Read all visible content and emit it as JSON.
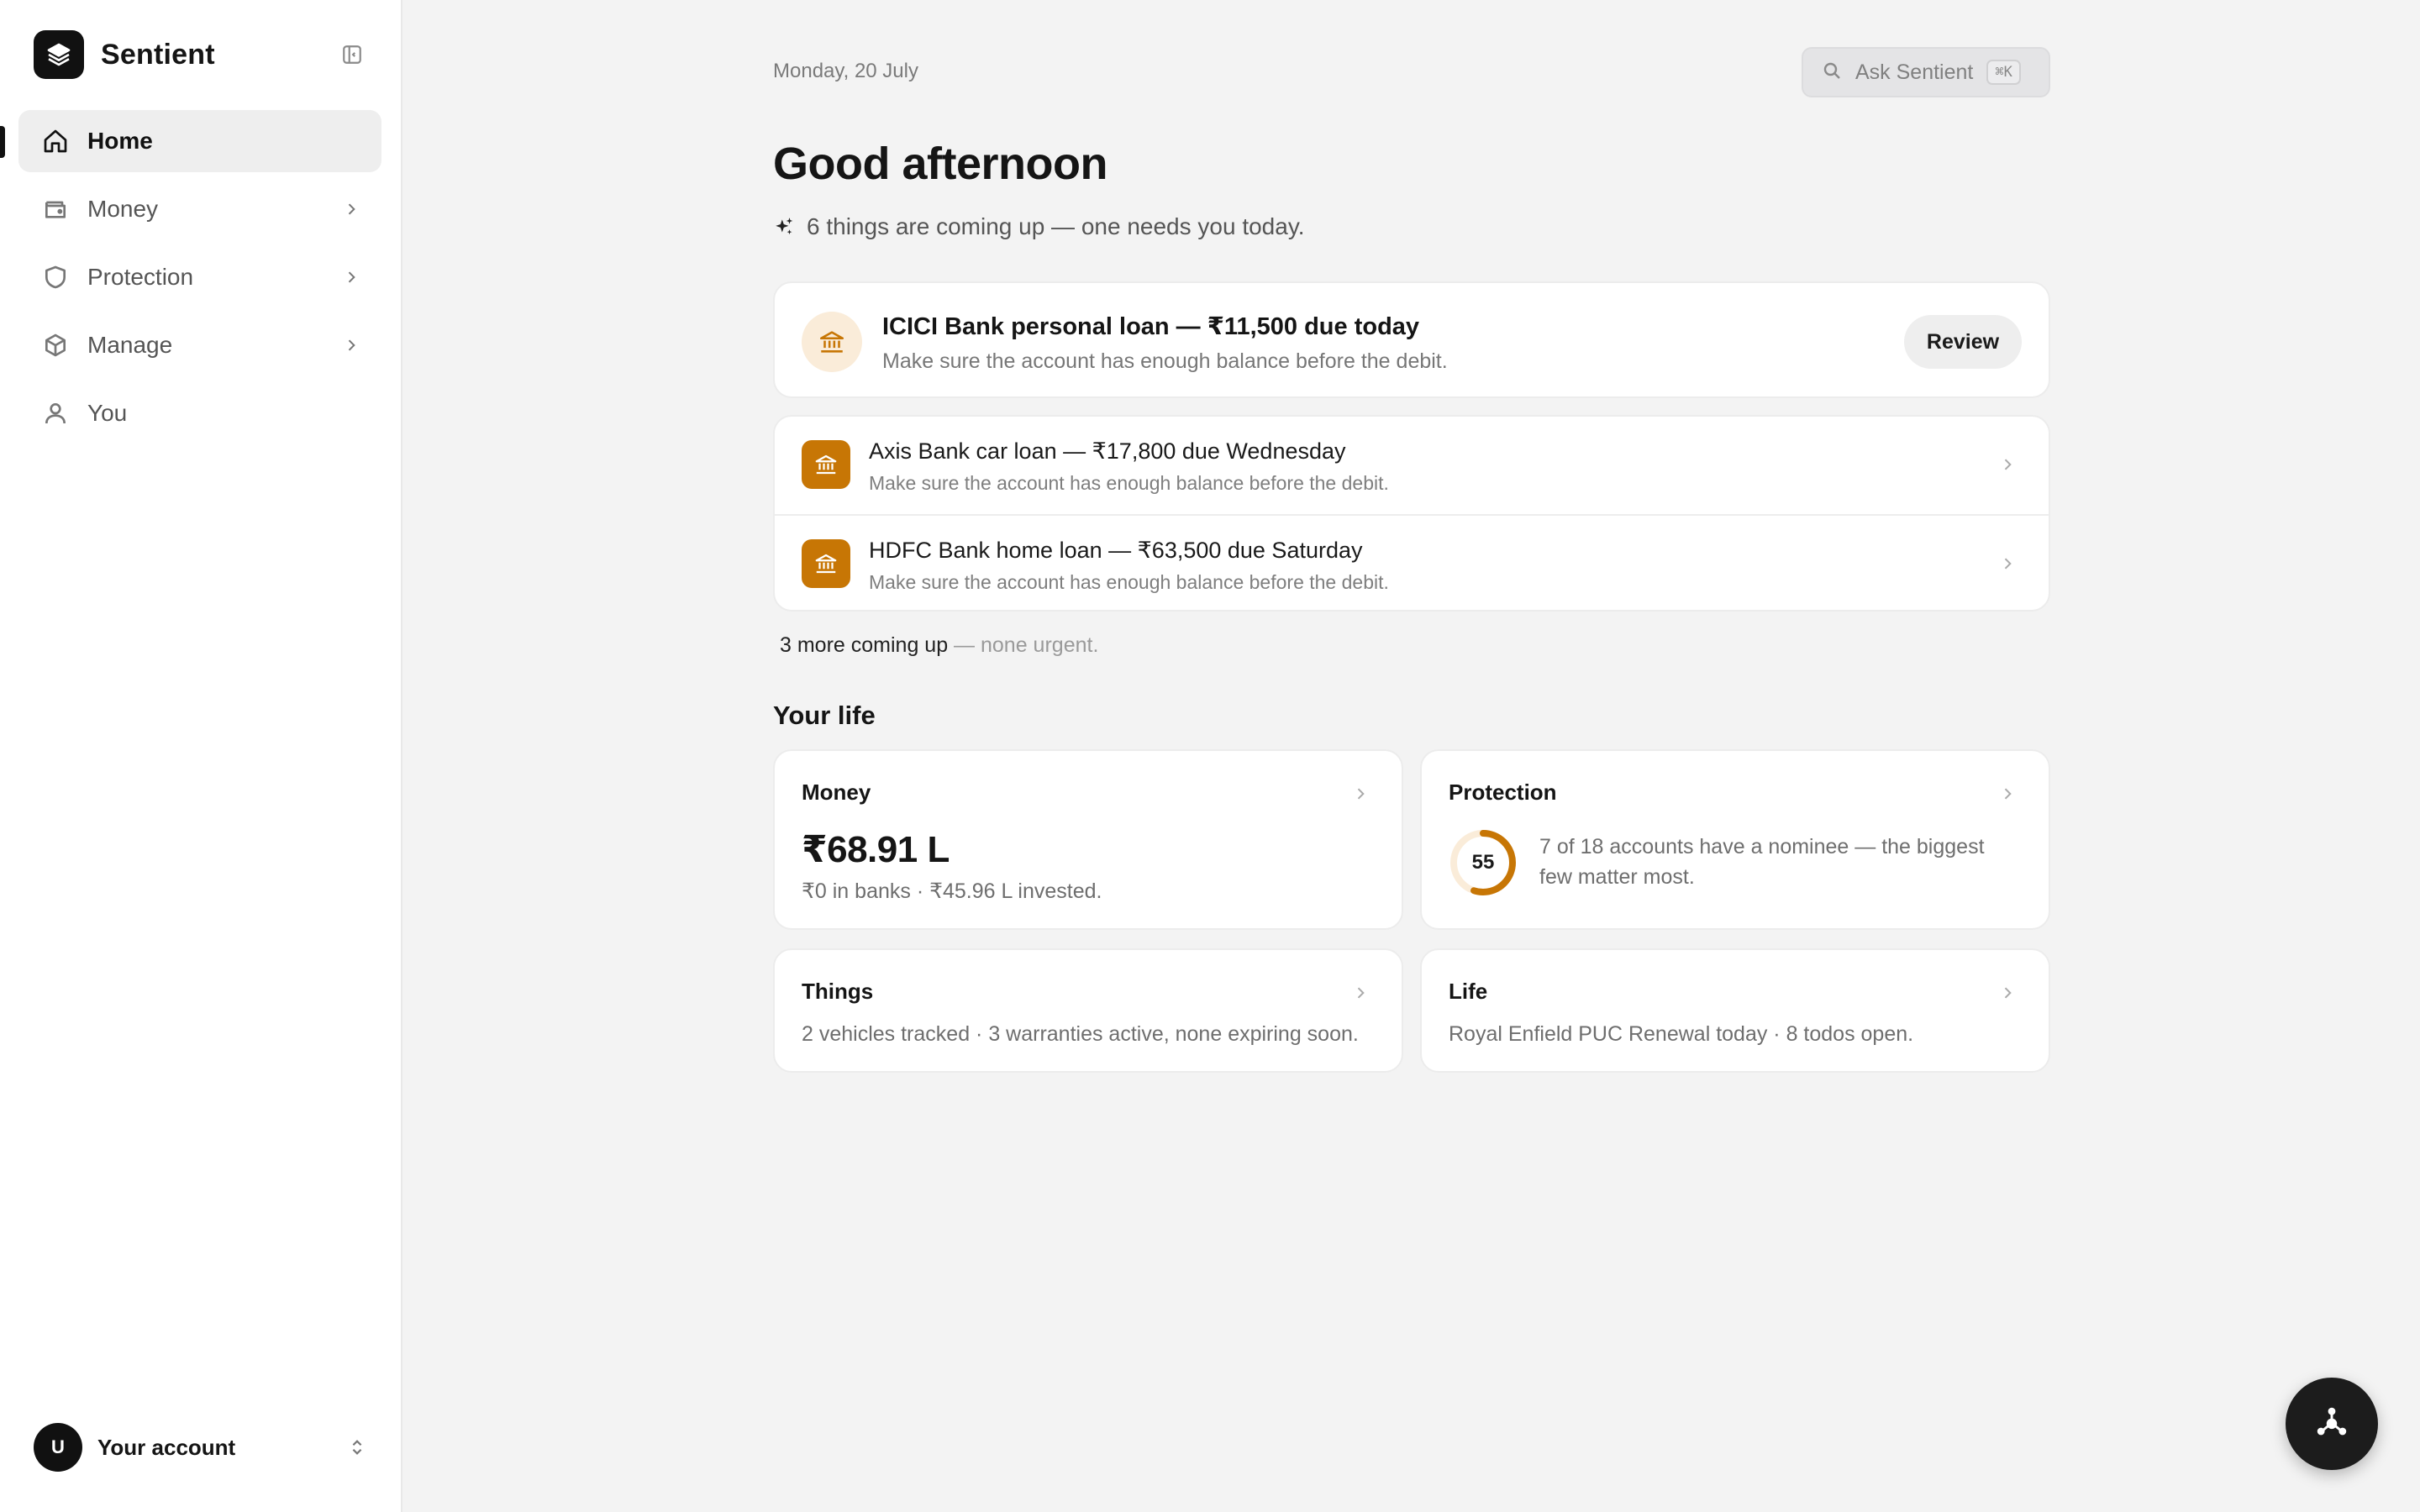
{
  "app": {
    "name": "Sentient"
  },
  "sidebar": {
    "items": [
      {
        "label": "Home",
        "icon": "home-icon",
        "active": true
      },
      {
        "label": "Money",
        "icon": "wallet-icon",
        "has_submenu": true
      },
      {
        "label": "Protection",
        "icon": "shield-icon",
        "has_submenu": true
      },
      {
        "label": "Manage",
        "icon": "box-icon",
        "has_submenu": true
      },
      {
        "label": "You",
        "icon": "user-icon"
      }
    ],
    "account": {
      "avatar_initial": "U",
      "label": "Your account"
    }
  },
  "header": {
    "date": "Monday, 20 July",
    "search": {
      "label": "Ask Sentient",
      "shortcut": "⌘K"
    }
  },
  "greeting": "Good afternoon",
  "summary": "6 things are coming up — one needs you today.",
  "urgent": {
    "title": "ICICI Bank personal loan — ₹11,500 due today",
    "subtitle": "Make sure the account has enough balance before the debit.",
    "action": "Review"
  },
  "upcoming": [
    {
      "title": "Axis Bank car loan — ₹17,800 due Wednesday",
      "subtitle": "Make sure the account has enough balance before the debit."
    },
    {
      "title": "HDFC Bank home loan — ₹63,500 due Saturday",
      "subtitle": "Make sure the account has enough balance before the debit."
    }
  ],
  "more": {
    "count_text": "3 more coming up",
    "note": " — none urgent."
  },
  "life": {
    "title": "Your life",
    "money": {
      "title": "Money",
      "amount": "₹68.91 L",
      "detail": "₹0 in banks · ₹45.96 L invested."
    },
    "protection": {
      "title": "Protection",
      "score": "55",
      "score_fraction": 0.55,
      "detail": "7 of 18 accounts have a nominee — the biggest few matter most."
    },
    "things": {
      "title": "Things",
      "detail": "2 vehicles tracked · 3 warranties active, none expiring soon."
    },
    "life": {
      "title": "Life",
      "detail": "Royal Enfield PUC Renewal today · 8 todos open."
    }
  },
  "colors": {
    "accent": "#c77605",
    "accent_soft": "#faecd9",
    "background": "#f3f3f3",
    "dark": "#111111"
  }
}
